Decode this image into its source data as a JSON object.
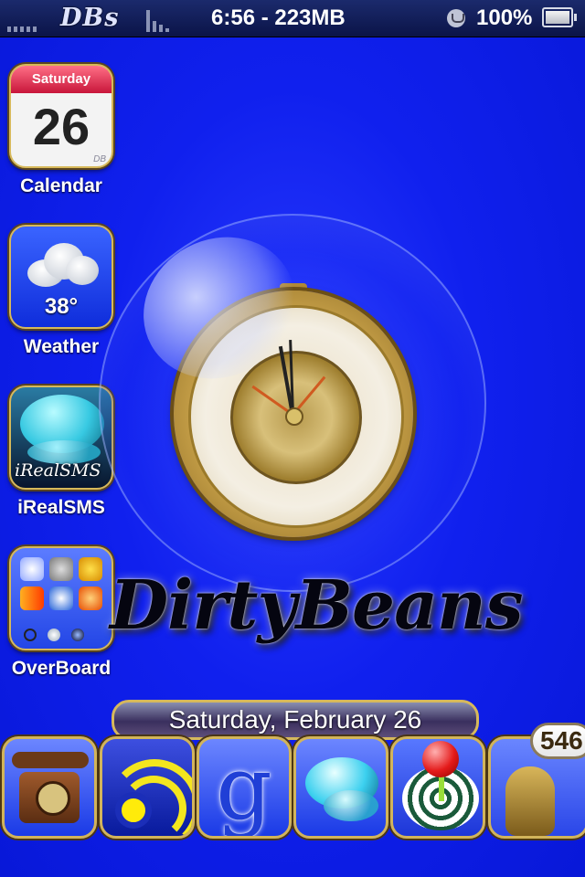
{
  "status_bar": {
    "carrier": "DBs",
    "time_memory": "6:56 - 223MB",
    "battery_percent": "100%"
  },
  "apps": [
    {
      "label": "Calendar",
      "weekday": "Saturday",
      "day": "26",
      "corner_mark": "DB"
    },
    {
      "label": "Weather",
      "temperature": "38°"
    },
    {
      "label": "iRealSMS",
      "icon_text": "iRealSMS"
    },
    {
      "label": "OverBoard"
    }
  ],
  "wallpaper": {
    "logo_text": "DirtyBeans"
  },
  "date_bar": {
    "text": "Saturday, February 26"
  },
  "dock": {
    "items": [
      "phone-icon",
      "rss-icon",
      "google-icon",
      "chat-icon",
      "joystick-icon",
      "hookah-icon"
    ],
    "badge": "546"
  }
}
